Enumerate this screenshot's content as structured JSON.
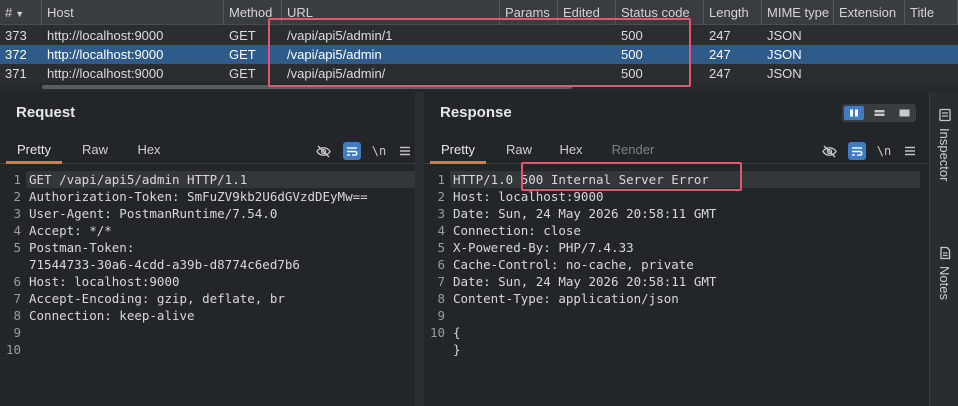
{
  "history": {
    "columns": {
      "num": "#",
      "host": "Host",
      "method": "Method",
      "url": "URL",
      "params": "Params",
      "edited": "Edited",
      "status": "Status code",
      "length": "Length",
      "mime": "MIME type",
      "ext": "Extension",
      "title": "Title"
    },
    "rows": [
      {
        "num": "373",
        "host": "http://localhost:9000",
        "method": "GET",
        "url": "/vapi/api5/admin/1",
        "status": "500",
        "length": "247",
        "mime": "JSON"
      },
      {
        "num": "372",
        "host": "http://localhost:9000",
        "method": "GET",
        "url": "/vapi/api5/admin",
        "status": "500",
        "length": "247",
        "mime": "JSON"
      },
      {
        "num": "371",
        "host": "http://localhost:9000",
        "method": "GET",
        "url": "/vapi/api5/admin/",
        "status": "500",
        "length": "247",
        "mime": "JSON"
      }
    ]
  },
  "request": {
    "title": "Request",
    "tabs": [
      "Pretty",
      "Raw",
      "Hex"
    ],
    "tools": {
      "newline": "\\n"
    },
    "lines": [
      {
        "n": "1",
        "t": "GET /vapi/api5/admin HTTP/1.1"
      },
      {
        "n": "2",
        "t": "Authorization-Token: SmFuZV9kb2U6dGVzdDEyMw=="
      },
      {
        "n": "3",
        "t": "User-Agent: PostmanRuntime/7.54.0"
      },
      {
        "n": "4",
        "t": "Accept: */*"
      },
      {
        "n": "5",
        "t": "Postman-Token:"
      },
      {
        "n": "",
        "t": "71544733-30a6-4cdd-a39b-d8774c6ed7b6"
      },
      {
        "n": "6",
        "t": "Host: localhost:9000"
      },
      {
        "n": "7",
        "t": "Accept-Encoding: gzip, deflate, br"
      },
      {
        "n": "8",
        "t": "Connection: keep-alive"
      },
      {
        "n": "9",
        "t": ""
      },
      {
        "n": "10",
        "t": ""
      }
    ]
  },
  "response": {
    "title": "Response",
    "tabs": [
      "Pretty",
      "Raw",
      "Hex",
      "Render"
    ],
    "tools": {
      "newline": "\\n"
    },
    "lines": [
      {
        "n": "1",
        "t": "HTTP/1.0 500 Internal Server Error"
      },
      {
        "n": "2",
        "t": "Host: localhost:9000"
      },
      {
        "n": "3",
        "t": "Date: Sun, 24 May 2026 20:58:11 GMT"
      },
      {
        "n": "4",
        "t": "Connection: close"
      },
      {
        "n": "5",
        "t": "X-Powered-By: PHP/7.4.33"
      },
      {
        "n": "6",
        "t": "Cache-Control: no-cache, private"
      },
      {
        "n": "7",
        "t": "Date: Sun, 24 May 2026 20:58:11 GMT"
      },
      {
        "n": "8",
        "t": "Content-Type: application/json"
      },
      {
        "n": "9",
        "t": ""
      },
      {
        "n": "10",
        "t": "{"
      },
      {
        "n": "",
        "t": "}"
      }
    ]
  },
  "sidebar": {
    "inspector": "Inspector",
    "notes": "Notes"
  },
  "colors": {
    "accent": "#3f7cc4",
    "selected_row": "#2f5b8a",
    "active_tab_underline": "#e07a3c",
    "highlight_box": "#e8556f"
  }
}
